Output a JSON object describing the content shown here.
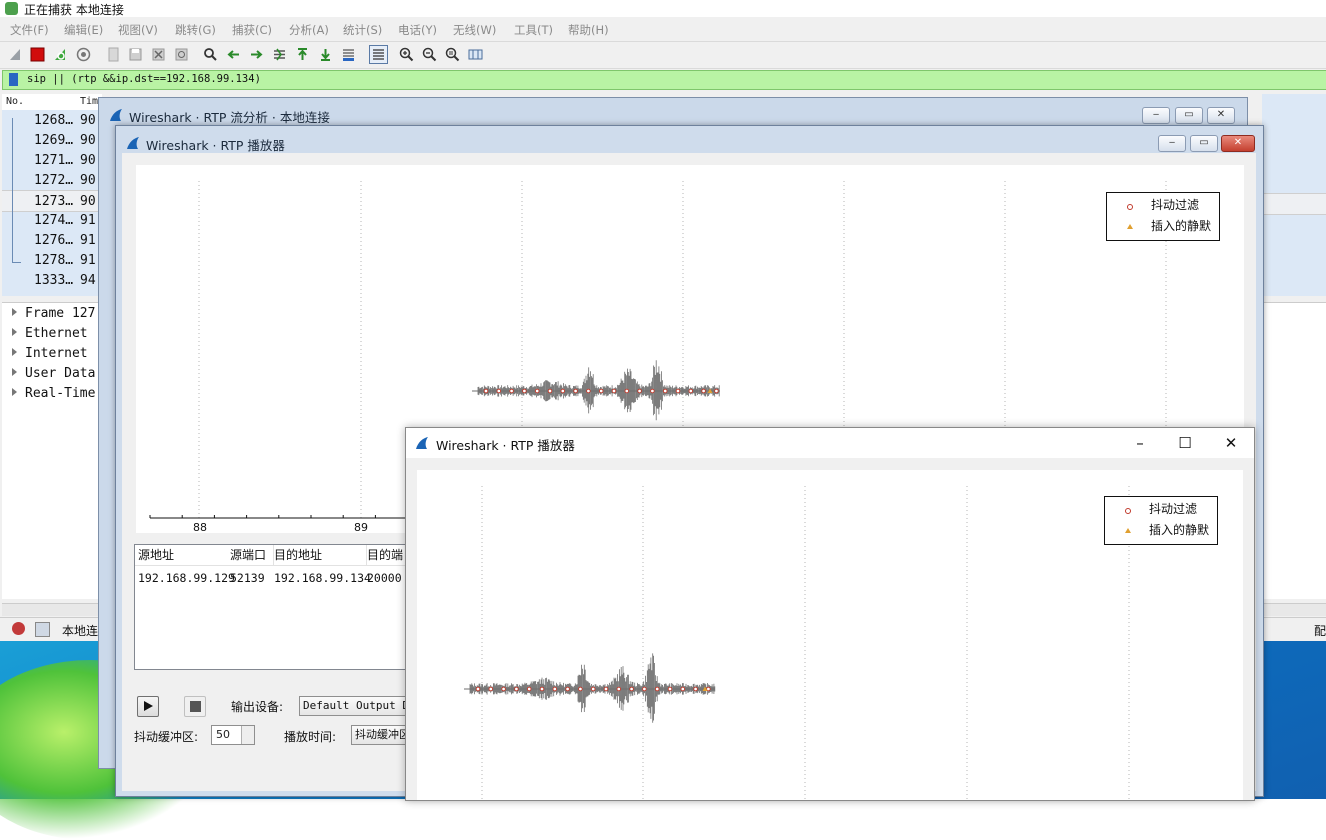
{
  "main_window": {
    "title": "正在捕获 本地连接",
    "menu": [
      "文件(F)",
      "编辑(E)",
      "视图(V)",
      "跳转(G)",
      "捕获(C)",
      "分析(A)",
      "统计(S)",
      "电话(Y)",
      "无线(W)",
      "工具(T)",
      "帮助(H)"
    ],
    "filter_text": "sip || (rtp &&ip.dst==192.168.99.134)",
    "packet_columns": {
      "no": "No.",
      "time": "Tim"
    },
    "packets": [
      {
        "no": "1268…",
        "time": "90"
      },
      {
        "no": "1269…",
        "time": "90"
      },
      {
        "no": "1271…",
        "time": "90"
      },
      {
        "no": "1272…",
        "time": "90"
      },
      {
        "no": "1273…",
        "time": "90"
      },
      {
        "no": "1274…",
        "time": "91"
      },
      {
        "no": "1276…",
        "time": "91"
      },
      {
        "no": "1278…",
        "time": "91"
      },
      {
        "no": "1333…",
        "time": "94"
      }
    ],
    "selected_packet_index": 4,
    "details": [
      "Frame 127",
      "Ethernet",
      "Internet",
      "User Data",
      "Real-Time"
    ],
    "status_label": "本地连",
    "status_right": "配"
  },
  "rtp_analysis_window": {
    "title": "Wireshark · RTP 流分析 · 本地连接"
  },
  "player1": {
    "title": "Wireshark · RTP 播放器",
    "legend": {
      "jitter": "抖动过滤",
      "silence": "插入的静默"
    },
    "axis_ticks": [
      "88",
      "89"
    ],
    "table_headers": [
      "源地址",
      "源端口",
      "目的地址",
      "目的端"
    ],
    "table_row": [
      "192.168.99.129",
      "52139",
      "192.168.99.134",
      "20000"
    ],
    "controls": {
      "output_device_label": "输出设备:",
      "output_device_value": "Default Output Dev",
      "jitter_buffer_label": "抖动缓冲区:",
      "jitter_buffer_value": "50",
      "playback_time_label": "播放时间:",
      "playback_time_value": "抖动缓冲区"
    }
  },
  "player2": {
    "title": "Wireshark · RTP 播放器",
    "legend": {
      "jitter": "抖动过滤",
      "silence": "插入的静默"
    }
  },
  "colors": {
    "filter_bg": "#b9f3a4",
    "selection": "#dce8f6",
    "wave": "#6e6e6e",
    "jitter_marker": "#c0392b",
    "silence_marker": "#e0a030"
  }
}
